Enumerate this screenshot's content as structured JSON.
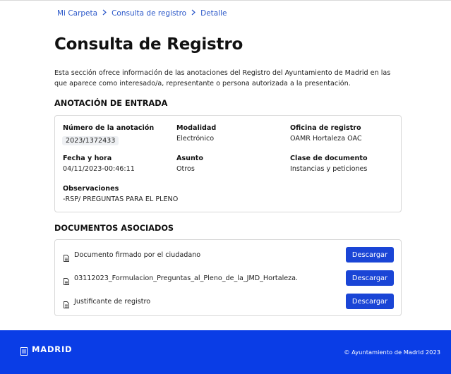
{
  "breadcrumb": {
    "items": [
      "Mi Carpeta",
      "Consulta de registro",
      "Detalle"
    ]
  },
  "page_title": "Consulta de Registro",
  "intro": "Esta sección ofrece información de las anotaciones del Registro del Ayuntamiento de Madrid en las que aparece como interesado/a, representante o persona autorizada a la presentación.",
  "entrada": {
    "section_title": "ANOTACIÓN DE ENTRADA",
    "numero": {
      "label": "Número de la anotación",
      "value": "2023/1372433"
    },
    "modalidad": {
      "label": "Modalidad",
      "value": "Electrónico"
    },
    "oficina": {
      "label": "Oficina de registro",
      "value": "OAMR Hortaleza OAC"
    },
    "fecha": {
      "label": "Fecha y hora",
      "value": "04/11/2023-00:46:11"
    },
    "asunto": {
      "label": "Asunto",
      "value": "Otros"
    },
    "clase": {
      "label": "Clase de documento",
      "value": "Instancias y peticiones"
    },
    "observaciones": {
      "label": "Observaciones",
      "value": "-RSP/ PREGUNTAS PARA EL PLENO"
    }
  },
  "documentos": {
    "section_title": "DOCUMENTOS ASOCIADOS",
    "items": [
      {
        "name": "Documento firmado por el ciudadano",
        "button": "Descargar"
      },
      {
        "name": "03112023_Formulacion_Preguntas_al_Pleno_de_la_JMD_Hortaleza.",
        "button": "Descargar"
      },
      {
        "name": "Justificante de registro",
        "button": "Descargar"
      }
    ]
  },
  "footer": {
    "logo_text": "MADRID",
    "copyright": "© Ayuntamiento de Madrid 2023"
  },
  "colors": {
    "accent": "#1a45d6",
    "footer_bg": "#0a3de6",
    "link": "#2a57c9"
  },
  "icons": {
    "breadcrumb_separator": "chevron-right-icon",
    "document": "document-icon",
    "logo": "madrid-logo-icon"
  }
}
